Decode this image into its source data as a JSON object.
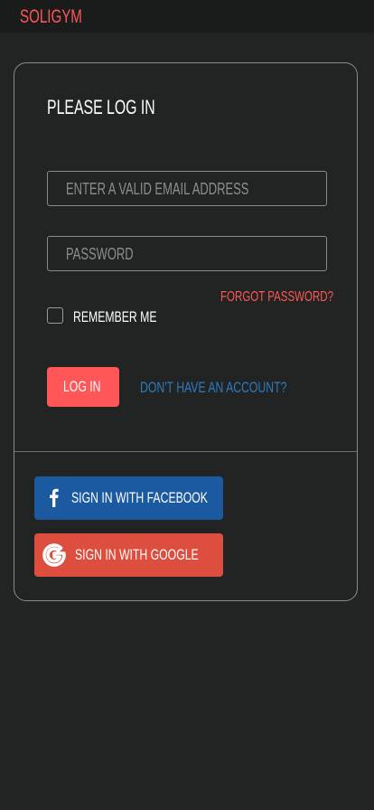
{
  "header": {
    "brand": "SOLIGYM"
  },
  "login_form": {
    "title": "PLEASE LOG IN",
    "email_placeholder": "ENTER A VALID EMAIL ADDRESS",
    "password_placeholder": "PASSWORD",
    "forgot_password": "FORGOT PASSWORD?",
    "remember_me": "REMEMBER ME",
    "remember_checked": false,
    "login_button": "LOG IN",
    "signup_link": "DON'T HAVE AN ACCOUNT?"
  },
  "social_login": {
    "facebook": {
      "label": "SIGN IN WITH FACEBOOK",
      "icon": "facebook-icon",
      "color": "#1b5aa0"
    },
    "google": {
      "label": "SIGN IN WITH GOOGLE",
      "icon": "google-icon",
      "color": "#dd4e3e"
    }
  },
  "colors": {
    "accent": "#ff5757",
    "link": "#2e7bbf",
    "background": "#222423",
    "topbar": "#1a1c1b"
  }
}
